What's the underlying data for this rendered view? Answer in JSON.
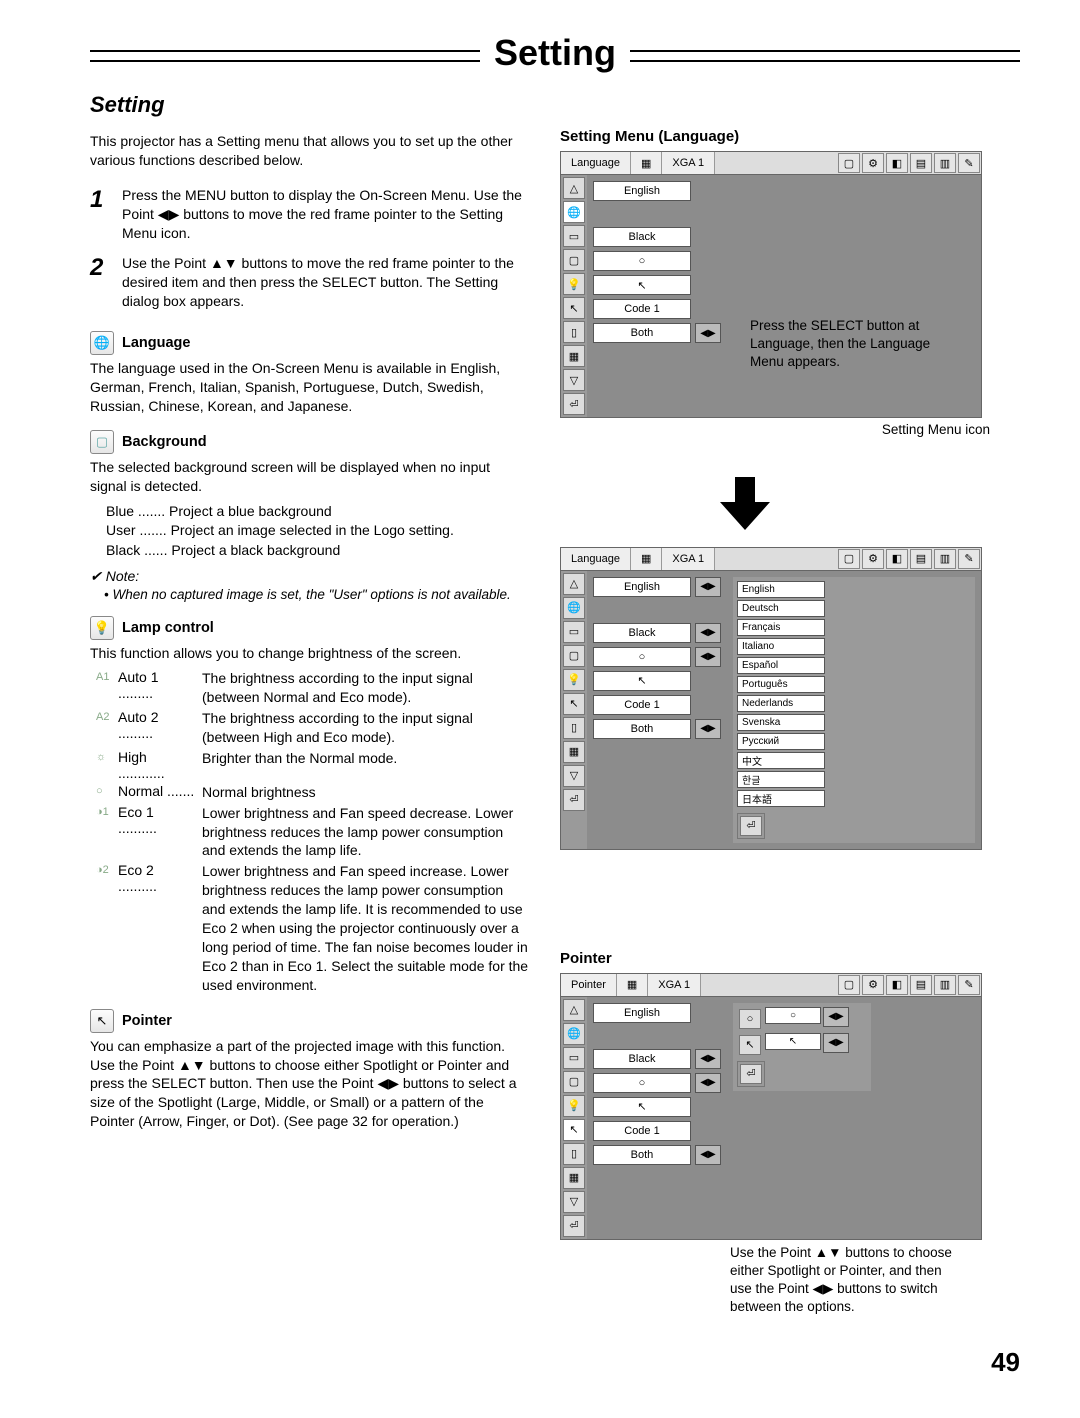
{
  "header": {
    "title": "Setting"
  },
  "subtitle": "Setting",
  "intro": "This projector has a Setting menu that allows you to set up the other various functions described below.",
  "steps": [
    {
      "num": "1",
      "text": "Press the MENU button to display the On-Screen Menu. Use the Point ◀▶ buttons to move the red frame pointer to the Setting Menu icon."
    },
    {
      "num": "2",
      "text": "Use the Point ▲▼ buttons to move the red frame pointer to the desired item and then press the SELECT button. The Setting dialog box appears."
    }
  ],
  "language": {
    "title": "Language",
    "text": "The language used in the On-Screen Menu is available in English, German, French, Italian, Spanish, Portuguese, Dutch, Swedish, Russian, Chinese, Korean, and Japanese."
  },
  "background": {
    "title": "Background",
    "text": "The selected background screen will be displayed when no input signal is detected.",
    "options": [
      "Blue ....... Project a blue background",
      "User ....... Project an image selected in the Logo setting.",
      "Black ...... Project a black background"
    ]
  },
  "note": {
    "head": "Note:",
    "body": "• When no captured image is set, the \"User\" options is not available."
  },
  "lamp": {
    "title": "Lamp control",
    "text": "This function allows you to change brightness of the screen.",
    "modes": [
      {
        "icon": "A1",
        "name": "Auto 1 .........",
        "desc": "The brightness according to the input signal (between Normal and Eco mode)."
      },
      {
        "icon": "A2",
        "name": "Auto 2 .........",
        "desc": "The brightness according to the input signal (between High and Eco mode)."
      },
      {
        "icon": "☼",
        "name": "High ............",
        "desc": "Brighter than the Normal mode."
      },
      {
        "icon": "○",
        "name": "Normal .......",
        "desc": "Normal brightness"
      },
      {
        "icon": "◑1",
        "name": "Eco 1 ..........",
        "desc": "Lower brightness and Fan speed decrease. Lower brightness reduces the lamp power consumption and extends the lamp life."
      },
      {
        "icon": "◑2",
        "name": "Eco 2 ..........",
        "desc": "Lower brightness and Fan speed increase. Lower brightness reduces the lamp power consumption and extends the lamp life. It is recommended to use Eco 2 when using the projector continuously over a long period of time. The fan noise becomes louder in Eco 2 than in Eco 1. Select the suitable mode for the used environment."
      }
    ]
  },
  "pointer": {
    "title": "Pointer",
    "text": "You can emphasize a part of the projected image with this function. Use the Point ▲▼ buttons to choose either Spotlight or Pointer and press the SELECT button. Then use the Point ◀▶ buttons to select a size of the Spotlight (Large, Middle, or Small) or a pattern of the Pointer (Arrow, Finger, or Dot). (See page 32 for operation.)"
  },
  "right": {
    "sec1_title": "Setting Menu (Language)",
    "icon_label": "Setting Menu icon",
    "press_note": "Press the SELECT button at Language, then the Language Menu appears.",
    "sec3_title": "Pointer",
    "pointer_note": "Use the Point ▲▼ buttons to choose either Spotlight or Pointer, and then use the Point ◀▶ buttons to switch between the options."
  },
  "menu": {
    "tab1": "Language",
    "tab2": "XGA 1",
    "rows": {
      "english": "English",
      "black": "Black",
      "lamp": "○",
      "pointer": "↖",
      "code": "Code 1",
      "both": "Both"
    },
    "languages": [
      "English",
      "Deutsch",
      "Français",
      "Italiano",
      "Español",
      "Português",
      "Nederlands",
      "Svenska",
      "Русский",
      "中文",
      "한글",
      "日本語"
    ],
    "pointer_tab": "Pointer"
  },
  "page_number": "49"
}
